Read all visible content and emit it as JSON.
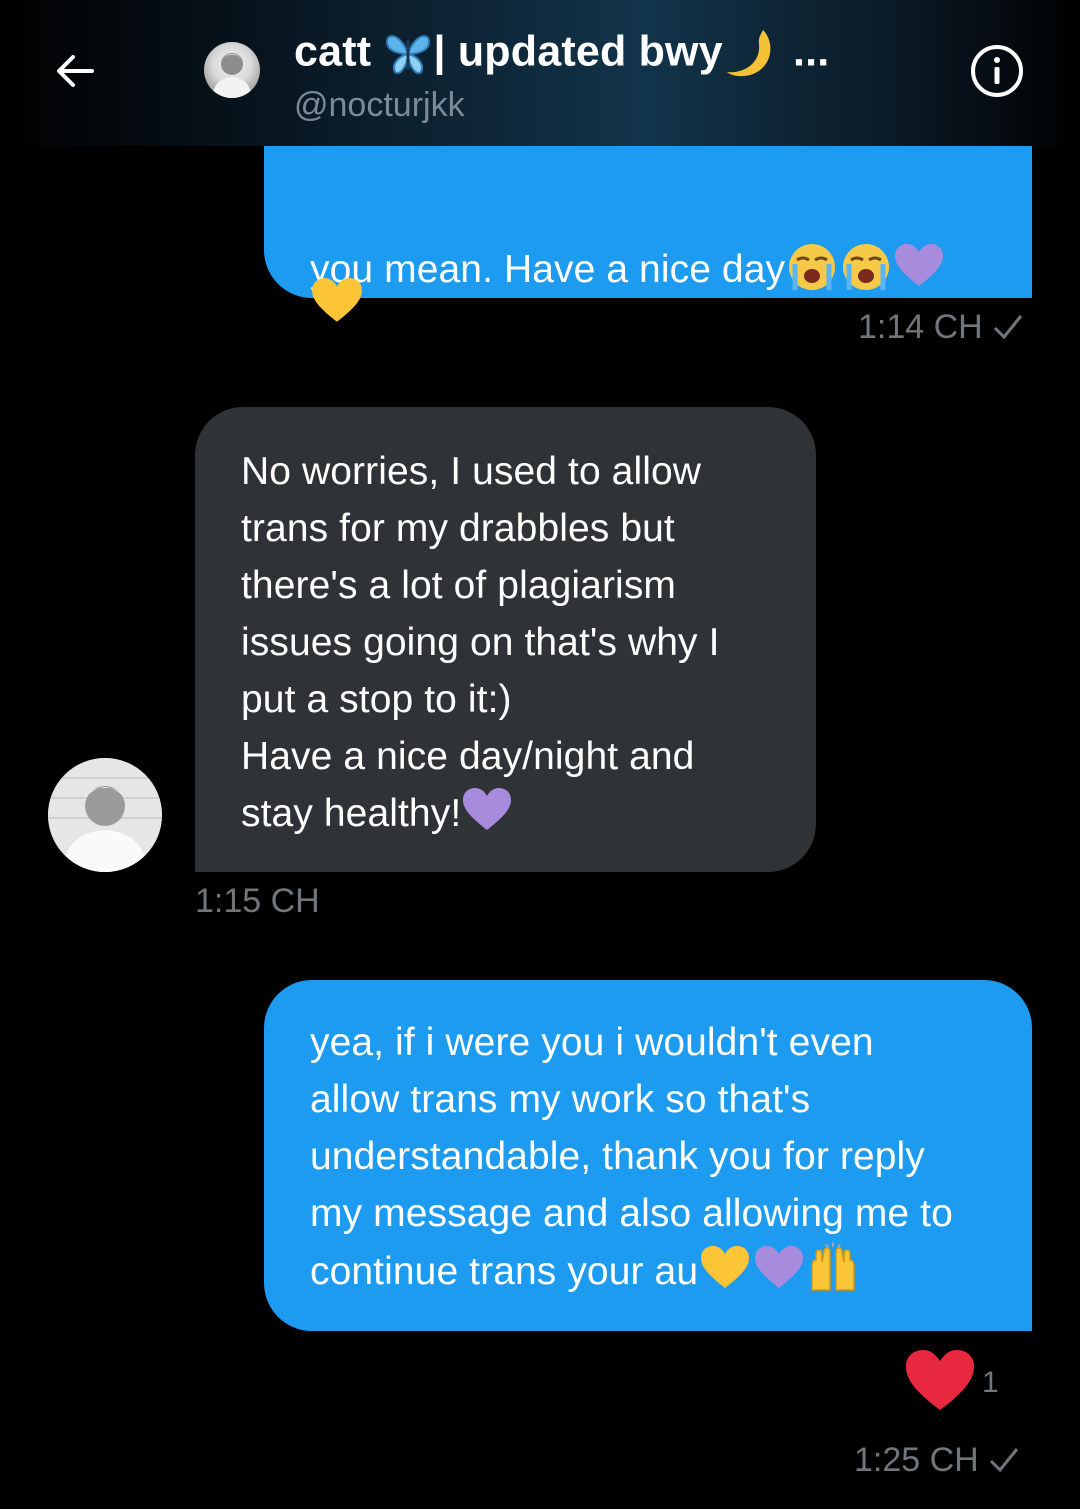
{
  "header": {
    "title_prefix": "catt",
    "title_middle": "| updated bwy",
    "title_ellipsis": "...",
    "handle": "@nocturjkk"
  },
  "messages": [
    {
      "direction": "sent",
      "lines": [
        "you mean. Have a nice day"
      ],
      "emojis": [
        "loudly-crying-face",
        "loudly-crying-face",
        "purple-heart",
        "yellow-heart"
      ],
      "timestamp": "1:14 CH",
      "status": "sent"
    },
    {
      "direction": "received",
      "lines": [
        "No worries, I used to allow",
        "trans for my drabbles but",
        "there's a lot of plagiarism",
        "issues going on that's why I",
        "put a stop to it:)",
        "Have a nice day/night and",
        "stay healthy!"
      ],
      "emojis": [
        "purple-heart"
      ],
      "timestamp": "1:15 CH"
    },
    {
      "direction": "sent",
      "lines": [
        "yea, if i were you i wouldn't even",
        "allow trans my work so that's",
        "understandable, thank you for reply",
        "my message and also allowing me to",
        "continue trans your au"
      ],
      "emojis": [
        "yellow-heart",
        "purple-heart",
        "raising-hands"
      ],
      "reaction": {
        "emoji": "red-heart",
        "count": "1"
      },
      "timestamp": "1:25 CH",
      "status": "sent"
    }
  ],
  "colors": {
    "sent_bubble": "#1d9bf0",
    "received_bubble": "#2f3336",
    "timestamp": "#71767b",
    "handle": "#7b8a96"
  }
}
